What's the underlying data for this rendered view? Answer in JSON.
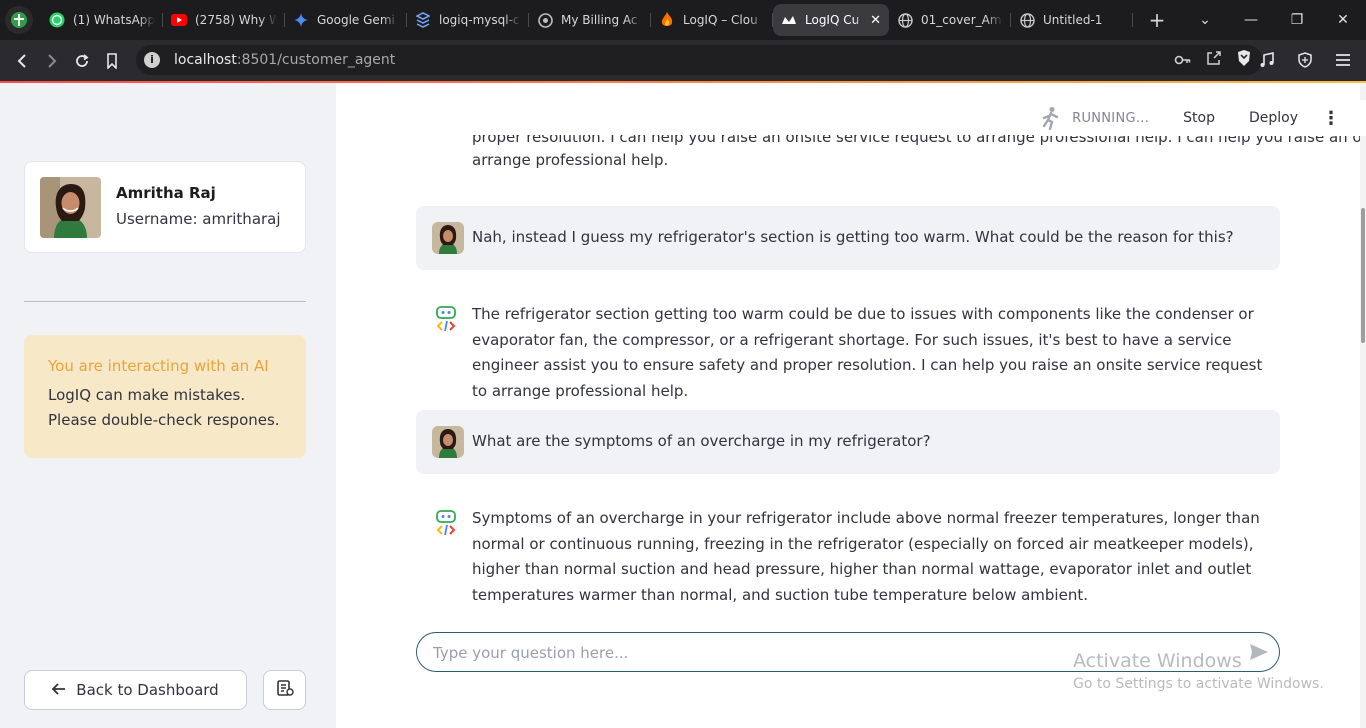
{
  "browser": {
    "tabs": [
      {
        "title": "(1) WhatsApp",
        "icon": "whatsapp-icon",
        "active": false
      },
      {
        "title": "(2758) Why W",
        "icon": "youtube-icon",
        "active": false
      },
      {
        "title": "Google Gemi",
        "icon": "gemini-icon",
        "active": false
      },
      {
        "title": "logiq-mysql-c",
        "icon": "stack-icon",
        "active": false
      },
      {
        "title": "My Billing Ac",
        "icon": "github-icon",
        "active": false
      },
      {
        "title": "LogIQ – Clou",
        "icon": "firebase-icon",
        "active": false
      },
      {
        "title": "LogIQ Cu",
        "icon": "streamlit-icon",
        "active": true
      },
      {
        "title": "01_cover_Am",
        "icon": "globe-icon",
        "active": false
      },
      {
        "title": "Untitled-1",
        "icon": "globe-icon",
        "active": false
      }
    ],
    "new_tab": "+",
    "url_host": "localhost",
    "url_rest": ":8501/customer_agent"
  },
  "header": {
    "status": "RUNNING...",
    "stop_label": "Stop",
    "deploy_label": "Deploy"
  },
  "sidebar": {
    "profile_name": "Amritha Raj",
    "profile_username": "Username: amritharaj",
    "warning_title": "You are interacting with an AI",
    "warning_body": "LogIQ can make mistakes. Please double-check respones.",
    "back_label": "Back to Dashboard"
  },
  "chat": {
    "partial_prev_line": "proper resolution. I can help you raise an onsite service request to arrange professional help. I can help you raise an onsite service request to",
    "partial_prev_tail": "arrange professional help.",
    "messages": [
      {
        "role": "user",
        "text": "Nah, instead I guess my refrigerator's section is getting too warm. What could be the reason for this?"
      },
      {
        "role": "assistant",
        "text": "The refrigerator section getting too warm could be due to issues with components like the condenser or evaporator fan, the compressor, or a refrigerant shortage. For such issues, it's best to have a service engineer assist you to ensure safety and proper resolution. I can help you raise an onsite service request to arrange professional help."
      },
      {
        "role": "user",
        "text": "What are the symptoms of an overcharge in my refrigerator?"
      },
      {
        "role": "assistant",
        "text": "Symptoms of an overcharge in your refrigerator include above normal freezer temperatures, longer than normal or continuous running, freezing in the refrigerator (especially on forced air meatkeeper models), higher than normal suction and head pressure, higher than normal wattage, evaporator inlet and outlet temperatures warmer than normal, and suction tube temperature below ambient."
      }
    ],
    "input_placeholder": "Type your question here..."
  },
  "overlay": {
    "activate_title": "Activate Windows",
    "activate_sub": "Go to Settings to activate Windows."
  },
  "colors": {
    "accent_gradient_start": "#ff4b4b",
    "accent_gradient_end": "#ffbd45",
    "sidebar_bg": "#f0f2f6",
    "warning_bg": "#f7e9c8",
    "warning_title": "#e8a33a",
    "input_border": "#2e5c6e"
  }
}
